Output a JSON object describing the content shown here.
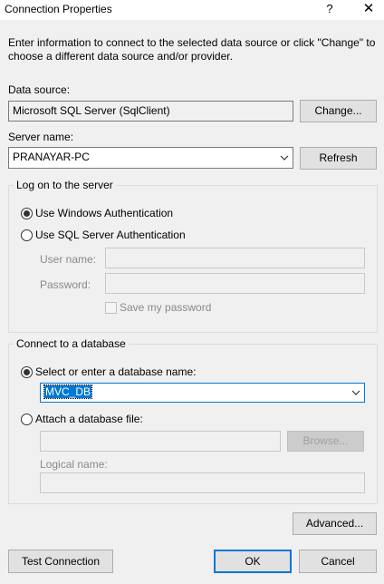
{
  "window": {
    "title": "Connection Properties",
    "help_glyph": "?",
    "close_glyph": "✕"
  },
  "instructions": "Enter information to connect to the selected data source or click \"Change\" to choose a different data source and/or provider.",
  "data_source": {
    "label": "Data source:",
    "value": "Microsoft SQL Server (SqlClient)",
    "change_button": "Change..."
  },
  "server": {
    "label": "Server name:",
    "value": "PRANAYAR-PC",
    "refresh_button": "Refresh"
  },
  "logon": {
    "group_title": "Log on to the server",
    "windows_auth": "Use Windows Authentication",
    "sql_auth": "Use SQL Server Authentication",
    "selected": "windows",
    "username_label": "User name:",
    "username_value": "",
    "password_label": "Password:",
    "password_value": "",
    "save_password": "Save my password"
  },
  "database": {
    "group_title": "Connect to a database",
    "select_option": "Select or enter a database name:",
    "db_name": "MVC_DB",
    "attach_option": "Attach a database file:",
    "attach_value": "",
    "browse_button": "Browse...",
    "logical_label": "Logical name:",
    "logical_value": ""
  },
  "footer": {
    "advanced_button": "Advanced...",
    "test_button": "Test Connection",
    "ok_button": "OK",
    "cancel_button": "Cancel"
  },
  "colors": {
    "accent": "#0078d7",
    "background": "#f0f0f0"
  }
}
